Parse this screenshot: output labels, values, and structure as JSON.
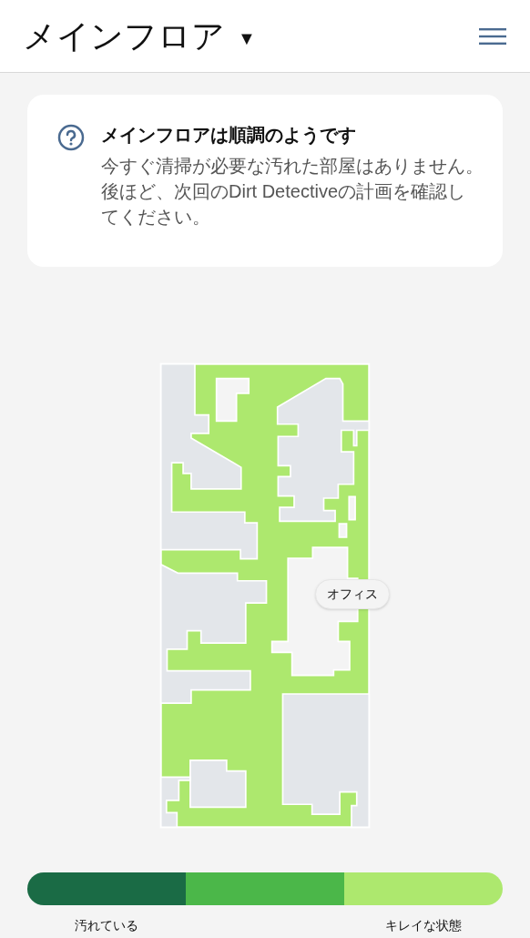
{
  "header": {
    "title": "メインフロア",
    "dropdown_glyph": "▼"
  },
  "notice": {
    "title": "メインフロアは順調のようです",
    "body": "今すぐ清掃が必要な汚れた部屋はありません。後ほど、次回のDirt Detectiveの計画を確認してください。"
  },
  "map": {
    "rooms": [
      {
        "label": "オフィス"
      }
    ]
  },
  "legend": {
    "segments": [
      {
        "color": "#1a6b45"
      },
      {
        "color": "#4bb749"
      },
      {
        "color": "#ade86e"
      }
    ],
    "labels": [
      "汚れている",
      "キレイな状態"
    ]
  }
}
